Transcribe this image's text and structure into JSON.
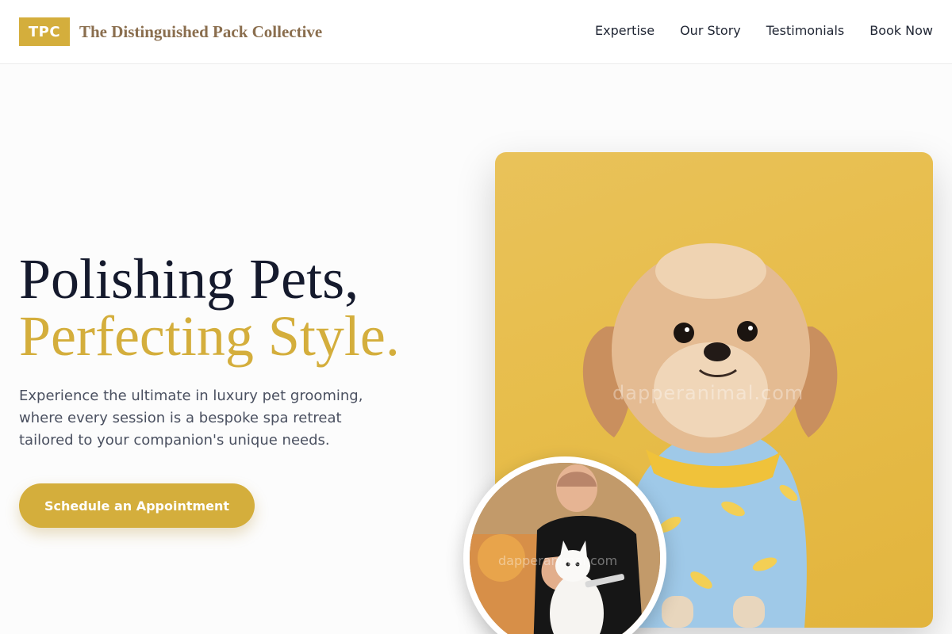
{
  "header": {
    "logo_badge": "TPC",
    "brand_name": "The Distinguished Pack Collective",
    "nav": [
      "Expertise",
      "Our Story",
      "Testimonials",
      "Book Now"
    ]
  },
  "hero": {
    "title_line1": "Polishing Pets,",
    "title_line2": "Perfecting Style.",
    "description": "Experience the ultimate in luxury pet grooming, where every session is a bespoke spa retreat tailored to your companion's unique needs.",
    "cta_label": "Schedule an Appointment"
  },
  "photos": {
    "main_watermark": "dapperanimal.com",
    "round_watermark": "dapperanimal.com"
  },
  "colors": {
    "accent": "#d4ae3c",
    "brand_text": "#8a6e4e",
    "heading": "#151a2d",
    "body_text": "#4a5060"
  }
}
